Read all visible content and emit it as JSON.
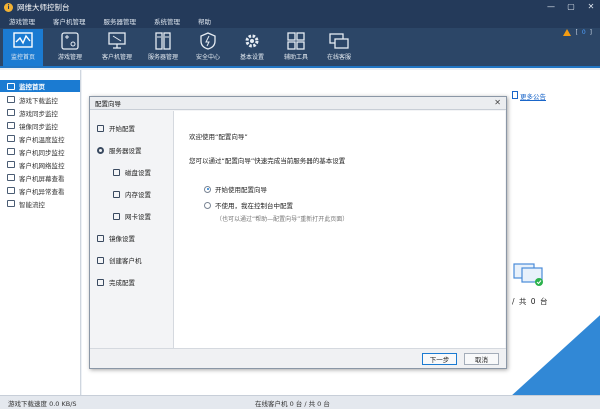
{
  "app": {
    "title": "网维大师控制台",
    "logo_glyph": "i"
  },
  "window_buttons": {
    "minimize": "—",
    "restore": "▢",
    "close": "✕"
  },
  "menu": [
    "游戏管理",
    "客户机管理",
    "服务器管理",
    "系统管理",
    "帮助"
  ],
  "toolbar": [
    {
      "label": "监控首页",
      "icon": "monitor-chart-icon",
      "active": true
    },
    {
      "label": "游戏管理",
      "icon": "gamepad-icon"
    },
    {
      "label": "客户机管理",
      "icon": "client-pc-icon"
    },
    {
      "label": "服务器管理",
      "icon": "server-icon"
    },
    {
      "label": "安全中心",
      "icon": "shield-icon"
    },
    {
      "label": "基本设置",
      "icon": "gear-icon"
    },
    {
      "label": "辅助工具",
      "icon": "tools-grid-icon"
    },
    {
      "label": "在线客服",
      "icon": "chat-icon"
    }
  ],
  "toolbar_right": {
    "warn_count_open": "[",
    "warn_count": "0",
    "warn_count_close": "]"
  },
  "sidebar": [
    {
      "label": "监控首页",
      "active": true
    },
    {
      "label": "游戏下载监控"
    },
    {
      "label": "游戏同步监控"
    },
    {
      "label": "镜像同步监控"
    },
    {
      "label": "客户机温度监控"
    },
    {
      "label": "客户机同步监控"
    },
    {
      "label": "客户机网络监控"
    },
    {
      "label": "客户机屏幕查看"
    },
    {
      "label": "客户机异常查看"
    },
    {
      "label": "智能流控"
    }
  ],
  "main": {
    "notice_link": "更多公告",
    "clients_text": "/ 共 0 台"
  },
  "statusbar": {
    "download_speed": "游戏下载速度 0.0 KB/S",
    "online_clients": "在线客户机 0 台 / 共 0 台"
  },
  "dialog": {
    "title": "配置向导",
    "close": "✕",
    "nav": [
      {
        "label": "开始配置",
        "sub": false
      },
      {
        "label": "服务器设置",
        "sub": false
      },
      {
        "label": "磁盘设置",
        "sub": true
      },
      {
        "label": "内存设置",
        "sub": true
      },
      {
        "label": "网卡设置",
        "sub": true
      },
      {
        "label": "镜像设置",
        "sub": false
      },
      {
        "label": "创建客户机",
        "sub": false
      },
      {
        "label": "完成配置",
        "sub": false
      }
    ],
    "welcome": "欢迎使用“配置向导”",
    "description": "您可以通过“配置向导”快速完成当前服务器的基本设置",
    "options": [
      {
        "label": "开始使用配置向导",
        "selected": true
      },
      {
        "label": "不使用，我在控制台中配置",
        "selected": false
      }
    ],
    "hint": "（也可以通过“帮助—配置向导”重新打开此页面）",
    "buttons": {
      "next": "下一步",
      "cancel": "取消"
    }
  }
}
